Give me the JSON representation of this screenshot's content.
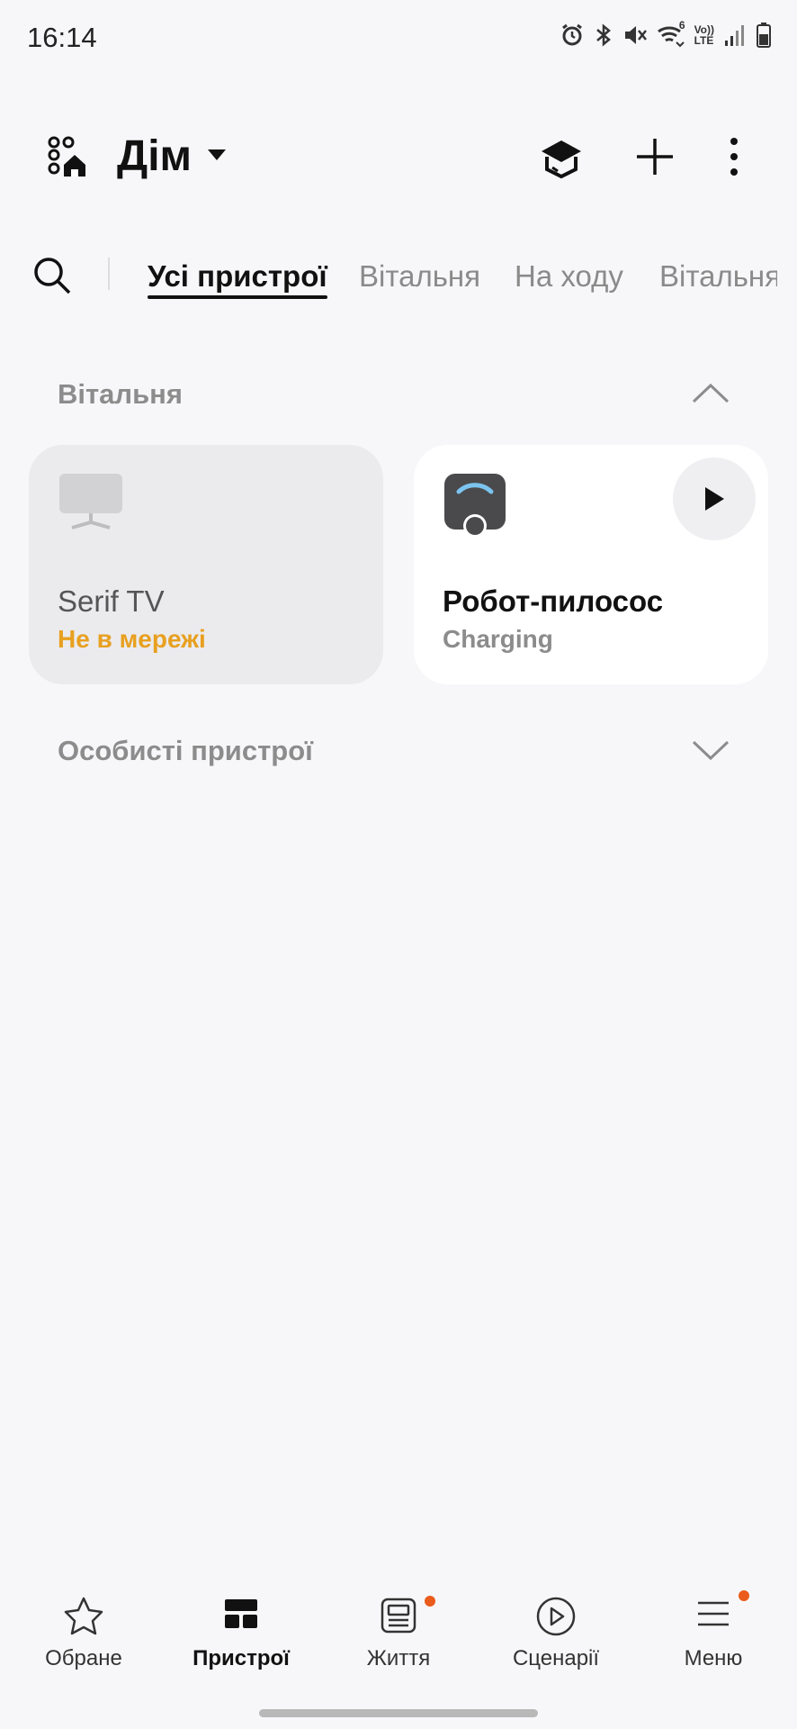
{
  "status_bar": {
    "time": "16:14",
    "icons": [
      "alarm-icon",
      "bluetooth-icon",
      "mute-icon",
      "wifi-icon",
      "volte-icon",
      "signal-icon",
      "battery-icon"
    ],
    "volte_text_top": "Vo))",
    "volte_text_bottom": "LTE",
    "wifi_text": "6"
  },
  "header": {
    "title": "Дім",
    "actions": [
      "tutorial-icon",
      "add-icon",
      "more-icon"
    ]
  },
  "tabs": {
    "items": [
      {
        "label": "Усі пристрої",
        "active": true
      },
      {
        "label": "Вітальня",
        "active": false
      },
      {
        "label": "На ходу",
        "active": false
      },
      {
        "label": "Вітальня",
        "active": false
      }
    ]
  },
  "sections": [
    {
      "title": "Вітальня",
      "expanded": true,
      "devices": [
        {
          "name": "Serif TV",
          "status": "Не в мережі",
          "status_color": "#e8a020",
          "online": false,
          "icon": "tv-icon"
        },
        {
          "name": "Робот-пилосос",
          "status": "Charging",
          "status_color": "#8c8c8c",
          "online": true,
          "icon": "robot-vacuum-icon"
        }
      ]
    },
    {
      "title": "Особисті пристрої",
      "expanded": false,
      "devices": []
    }
  ],
  "bottom_nav": {
    "items": [
      {
        "label": "Обране",
        "icon": "star-icon",
        "active": false,
        "badge": false
      },
      {
        "label": "Пристрої",
        "icon": "devices-grid-icon",
        "active": true,
        "badge": false
      },
      {
        "label": "Життя",
        "icon": "life-icon",
        "active": false,
        "badge": true
      },
      {
        "label": "Сценарії",
        "icon": "scenes-play-icon",
        "active": false,
        "badge": false
      },
      {
        "label": "Меню",
        "icon": "menu-icon",
        "active": false,
        "badge": true
      }
    ]
  },
  "colors": {
    "background": "#f7f7f9",
    "offline": "#e8a020",
    "badge": "#ea5b1c",
    "text_primary": "#111111",
    "text_secondary": "#8c8c8c"
  }
}
